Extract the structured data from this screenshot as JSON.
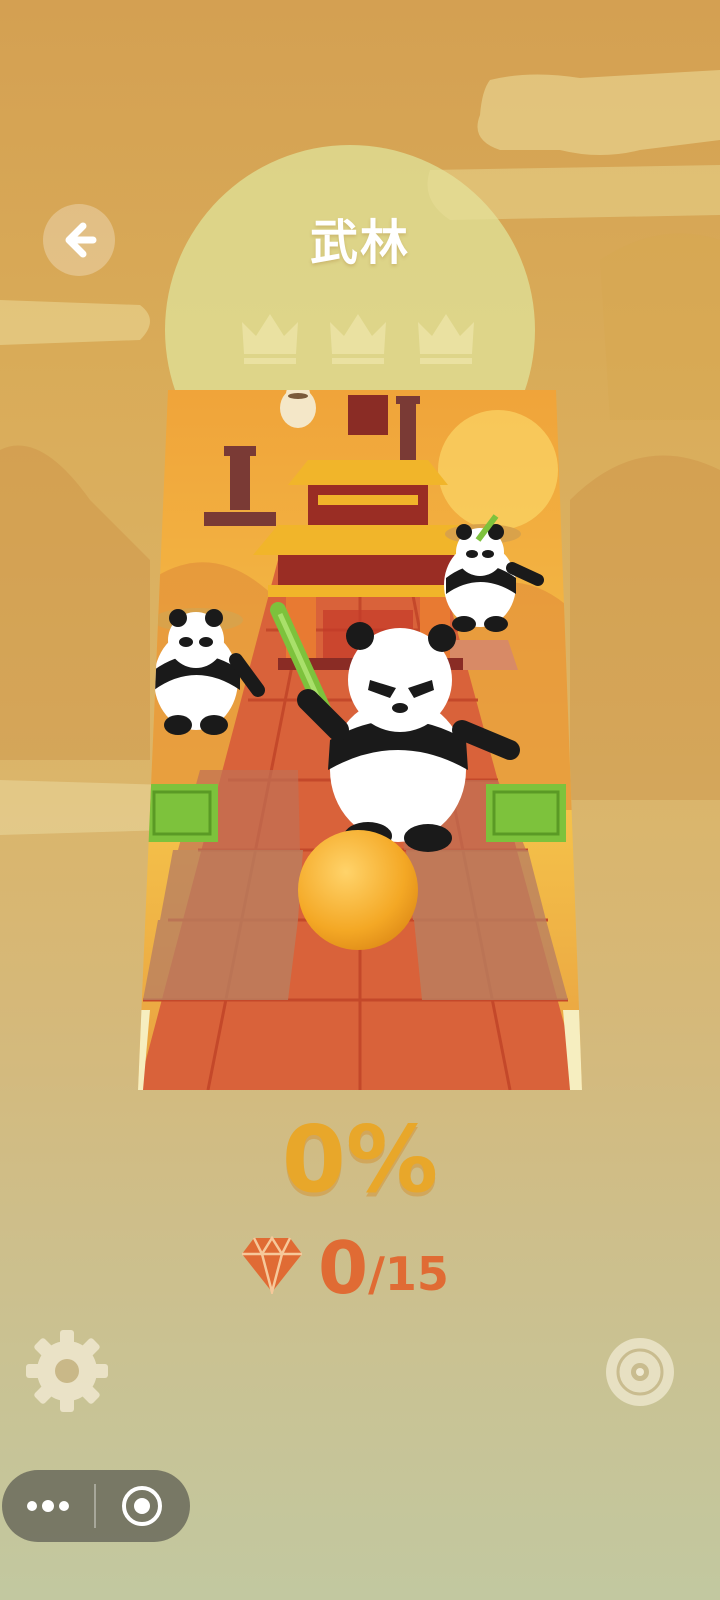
{
  "level": {
    "title": "武林",
    "crowns_earned": 0,
    "crowns_total": 3
  },
  "progress": {
    "percent_label": "0%",
    "percent_value": 0
  },
  "gems": {
    "collected": "0",
    "total": "/15"
  },
  "icons": {
    "back": "arrow-left-icon",
    "crown": "crown-icon",
    "gem": "diamond-icon",
    "settings": "gear-icon",
    "music": "music-disc-icon",
    "more": "more-dots-icon",
    "close": "target-close-icon"
  },
  "colors": {
    "percent": "#e8a72a",
    "gems": "#e06b34",
    "title": "#ffffff",
    "sun": "#dfe39a"
  }
}
